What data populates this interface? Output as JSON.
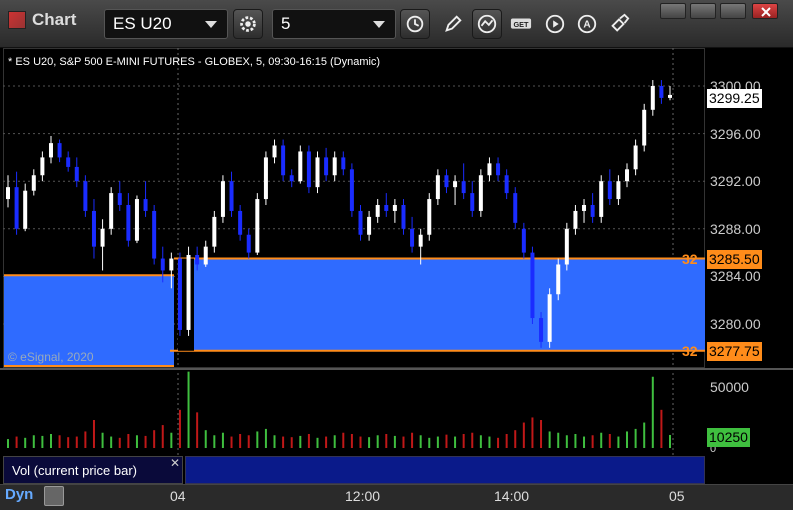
{
  "window": {
    "title": "Chart"
  },
  "toolbar": {
    "symbol": "ES U20",
    "interval": "5"
  },
  "chart": {
    "title": "* ES U20, S&P 500 E-MINI FUTURES - GLOBEX, 5, 09:30-16:15 (Dynamic)",
    "watermark": "© eSignal, 2020",
    "price_ticks": [
      "3300.00",
      "3296.00",
      "3292.00",
      "3288.00",
      "3284.00",
      "3280.00"
    ],
    "last_price": "3299.25",
    "zone_top": "3285.50",
    "zone_bottom": "3277.75",
    "zone_top_prefix": "32",
    "zone_bottom_prefix": "32",
    "volume_ticks": [
      "50000",
      "0"
    ],
    "last_volume": "10250",
    "volume_study": "Vol (current price bar)",
    "time_ticks": [
      "04",
      "12:00",
      "14:00",
      "05"
    ],
    "mode": "Dyn",
    "colors": {
      "up": "#ffffff",
      "down": "#1a2cff",
      "zone": "#2f6bff",
      "zone_line": "#ff8c1a",
      "vol_up": "#3fbf3f",
      "vol_down": "#c01818"
    }
  },
  "chart_data": {
    "type": "candlestick",
    "ylim": [
      3277,
      3301
    ],
    "candles": [
      [
        3290.5,
        3292.5,
        3289.8,
        3291.5
      ],
      [
        3291.5,
        3292.8,
        3287.5,
        3288.0
      ],
      [
        3288.0,
        3291.8,
        3287.8,
        3291.2
      ],
      [
        3291.2,
        3293.0,
        3290.8,
        3292.5
      ],
      [
        3292.5,
        3294.5,
        3292.0,
        3294.0
      ],
      [
        3294.0,
        3295.8,
        3293.5,
        3295.2
      ],
      [
        3295.2,
        3295.5,
        3293.6,
        3294.0
      ],
      [
        3294.0,
        3294.5,
        3292.8,
        3293.2
      ],
      [
        3293.2,
        3294.0,
        3291.5,
        3292.0
      ],
      [
        3292.0,
        3292.5,
        3289.0,
        3289.5
      ],
      [
        3289.5,
        3290.5,
        3285.5,
        3286.5
      ],
      [
        3286.5,
        3288.8,
        3284.5,
        3288.0
      ],
      [
        3288.0,
        3291.5,
        3287.5,
        3291.0
      ],
      [
        3291.0,
        3292.0,
        3289.5,
        3290.0
      ],
      [
        3290.0,
        3291.0,
        3286.5,
        3287.0
      ],
      [
        3287.0,
        3290.8,
        3286.8,
        3290.5
      ],
      [
        3290.5,
        3292.0,
        3289.0,
        3289.5
      ],
      [
        3289.5,
        3290.0,
        3285.0,
        3285.5
      ],
      [
        3285.5,
        3286.5,
        3283.5,
        3284.5
      ],
      [
        3284.5,
        3286.0,
        3283.0,
        3285.5
      ],
      [
        3285.5,
        3286.0,
        3279.0,
        3279.5
      ],
      [
        3279.5,
        3286.5,
        3279.0,
        3285.8
      ],
      [
        3285.8,
        3286.5,
        3284.5,
        3285.0
      ],
      [
        3285.0,
        3287.0,
        3284.8,
        3286.5
      ],
      [
        3286.5,
        3289.5,
        3286.0,
        3289.0
      ],
      [
        3289.0,
        3292.5,
        3288.5,
        3292.0
      ],
      [
        3292.0,
        3292.8,
        3289.0,
        3289.5
      ],
      [
        3289.5,
        3290.0,
        3287.0,
        3287.5
      ],
      [
        3287.5,
        3288.0,
        3285.5,
        3286.0
      ],
      [
        3286.0,
        3291.0,
        3285.8,
        3290.5
      ],
      [
        3290.5,
        3294.5,
        3290.0,
        3294.0
      ],
      [
        3294.0,
        3295.5,
        3293.5,
        3295.0
      ],
      [
        3295.0,
        3295.5,
        3292.0,
        3292.5
      ],
      [
        3292.5,
        3293.0,
        3291.5,
        3292.0
      ],
      [
        3292.0,
        3295.0,
        3291.8,
        3294.5
      ],
      [
        3294.5,
        3295.0,
        3291.0,
        3291.5
      ],
      [
        3291.5,
        3294.5,
        3291.0,
        3294.0
      ],
      [
        3294.0,
        3294.8,
        3292.0,
        3292.5
      ],
      [
        3292.5,
        3294.5,
        3292.0,
        3294.0
      ],
      [
        3294.0,
        3294.5,
        3292.5,
        3293.0
      ],
      [
        3293.0,
        3293.5,
        3289.0,
        3289.5
      ],
      [
        3289.5,
        3290.0,
        3287.0,
        3287.5
      ],
      [
        3287.5,
        3289.5,
        3287.0,
        3289.0
      ],
      [
        3289.0,
        3290.5,
        3288.5,
        3290.0
      ],
      [
        3290.0,
        3291.0,
        3289.0,
        3289.5
      ],
      [
        3289.5,
        3290.5,
        3288.5,
        3290.0
      ],
      [
        3290.0,
        3290.5,
        3287.5,
        3288.0
      ],
      [
        3288.0,
        3289.0,
        3286.0,
        3286.5
      ],
      [
        3286.5,
        3288.0,
        3285.0,
        3287.5
      ],
      [
        3287.5,
        3291.0,
        3287.0,
        3290.5
      ],
      [
        3290.5,
        3293.0,
        3290.0,
        3292.5
      ],
      [
        3292.5,
        3293.0,
        3291.0,
        3291.5
      ],
      [
        3291.5,
        3292.5,
        3290.0,
        3292.0
      ],
      [
        3292.0,
        3293.5,
        3290.5,
        3291.0
      ],
      [
        3291.0,
        3292.0,
        3289.0,
        3289.5
      ],
      [
        3289.5,
        3293.0,
        3289.0,
        3292.5
      ],
      [
        3292.5,
        3294.0,
        3292.0,
        3293.5
      ],
      [
        3293.5,
        3294.0,
        3292.0,
        3292.5
      ],
      [
        3292.5,
        3293.0,
        3290.5,
        3291.0
      ],
      [
        3291.0,
        3291.5,
        3288.0,
        3288.5
      ],
      [
        3288.0,
        3288.5,
        3285.5,
        3286.0
      ],
      [
        3286.0,
        3286.5,
        3280.0,
        3280.5
      ],
      [
        3280.5,
        3281.0,
        3278.0,
        3278.5
      ],
      [
        3278.5,
        3283.0,
        3278.0,
        3282.5
      ],
      [
        3282.5,
        3285.5,
        3282.0,
        3285.0
      ],
      [
        3285.0,
        3288.5,
        3284.5,
        3288.0
      ],
      [
        3288.0,
        3290.0,
        3287.5,
        3289.5
      ],
      [
        3289.5,
        3290.5,
        3288.5,
        3290.0
      ],
      [
        3290.0,
        3291.0,
        3288.5,
        3289.0
      ],
      [
        3289.0,
        3292.5,
        3288.5,
        3292.0
      ],
      [
        3292.0,
        3293.0,
        3290.0,
        3290.5
      ],
      [
        3290.5,
        3292.5,
        3290.0,
        3292.0
      ],
      [
        3292.0,
        3293.5,
        3291.5,
        3293.0
      ],
      [
        3293.0,
        3295.5,
        3292.5,
        3295.0
      ],
      [
        3295.0,
        3298.5,
        3294.5,
        3298.0
      ],
      [
        3298.0,
        3300.5,
        3297.5,
        3300.0
      ],
      [
        3300.0,
        3300.5,
        3298.5,
        3299.0
      ],
      [
        3299.0,
        3300.0,
        3298.8,
        3299.25
      ]
    ],
    "volume_ylim": [
      0,
      55000
    ],
    "volumes": [
      7000,
      9000,
      8000,
      10000,
      9500,
      11000,
      10000,
      8500,
      9000,
      13000,
      22000,
      12000,
      9000,
      8000,
      11000,
      10000,
      9500,
      14000,
      18000,
      12000,
      30000,
      60000,
      28000,
      14000,
      10000,
      12000,
      9000,
      11000,
      10000,
      13000,
      15000,
      10000,
      9000,
      8500,
      9500,
      11000,
      8000,
      9000,
      10000,
      12000,
      11000,
      9000,
      8500,
      10000,
      11000,
      9500,
      9000,
      12000,
      10000,
      8000,
      9000,
      10500,
      9000,
      11000,
      12000,
      10000,
      9000,
      8000,
      11000,
      14000,
      20000,
      24000,
      22000,
      13000,
      12000,
      10000,
      11000,
      9000,
      10000,
      12000,
      11000,
      9000,
      13000,
      15000,
      20000,
      56000,
      30000,
      10250
    ]
  }
}
